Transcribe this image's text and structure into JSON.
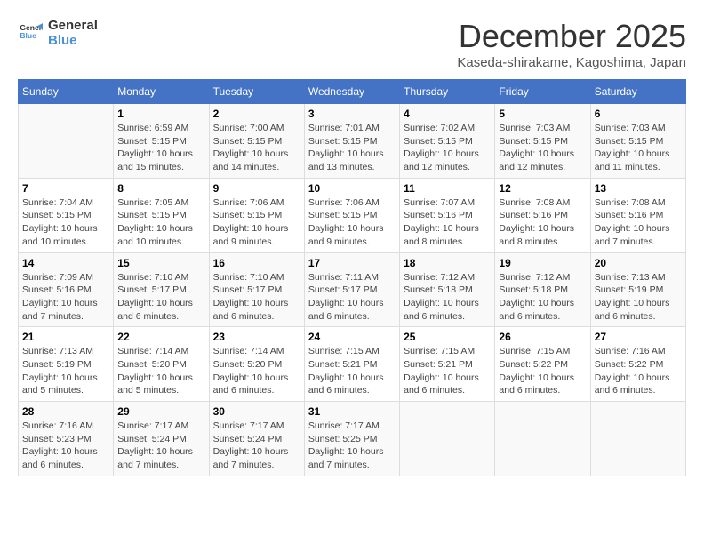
{
  "logo": {
    "line1": "General",
    "line2": "Blue"
  },
  "header": {
    "month_title": "December 2025",
    "location": "Kaseda-shirakame, Kagoshima, Japan"
  },
  "weekdays": [
    "Sunday",
    "Monday",
    "Tuesday",
    "Wednesday",
    "Thursday",
    "Friday",
    "Saturday"
  ],
  "weeks": [
    [
      {
        "day": "",
        "sunrise": "",
        "sunset": "",
        "daylight": ""
      },
      {
        "day": "1",
        "sunrise": "Sunrise: 6:59 AM",
        "sunset": "Sunset: 5:15 PM",
        "daylight": "Daylight: 10 hours and 15 minutes."
      },
      {
        "day": "2",
        "sunrise": "Sunrise: 7:00 AM",
        "sunset": "Sunset: 5:15 PM",
        "daylight": "Daylight: 10 hours and 14 minutes."
      },
      {
        "day": "3",
        "sunrise": "Sunrise: 7:01 AM",
        "sunset": "Sunset: 5:15 PM",
        "daylight": "Daylight: 10 hours and 13 minutes."
      },
      {
        "day": "4",
        "sunrise": "Sunrise: 7:02 AM",
        "sunset": "Sunset: 5:15 PM",
        "daylight": "Daylight: 10 hours and 12 minutes."
      },
      {
        "day": "5",
        "sunrise": "Sunrise: 7:03 AM",
        "sunset": "Sunset: 5:15 PM",
        "daylight": "Daylight: 10 hours and 12 minutes."
      },
      {
        "day": "6",
        "sunrise": "Sunrise: 7:03 AM",
        "sunset": "Sunset: 5:15 PM",
        "daylight": "Daylight: 10 hours and 11 minutes."
      }
    ],
    [
      {
        "day": "7",
        "sunrise": "Sunrise: 7:04 AM",
        "sunset": "Sunset: 5:15 PM",
        "daylight": "Daylight: 10 hours and 10 minutes."
      },
      {
        "day": "8",
        "sunrise": "Sunrise: 7:05 AM",
        "sunset": "Sunset: 5:15 PM",
        "daylight": "Daylight: 10 hours and 10 minutes."
      },
      {
        "day": "9",
        "sunrise": "Sunrise: 7:06 AM",
        "sunset": "Sunset: 5:15 PM",
        "daylight": "Daylight: 10 hours and 9 minutes."
      },
      {
        "day": "10",
        "sunrise": "Sunrise: 7:06 AM",
        "sunset": "Sunset: 5:15 PM",
        "daylight": "Daylight: 10 hours and 9 minutes."
      },
      {
        "day": "11",
        "sunrise": "Sunrise: 7:07 AM",
        "sunset": "Sunset: 5:16 PM",
        "daylight": "Daylight: 10 hours and 8 minutes."
      },
      {
        "day": "12",
        "sunrise": "Sunrise: 7:08 AM",
        "sunset": "Sunset: 5:16 PM",
        "daylight": "Daylight: 10 hours and 8 minutes."
      },
      {
        "day": "13",
        "sunrise": "Sunrise: 7:08 AM",
        "sunset": "Sunset: 5:16 PM",
        "daylight": "Daylight: 10 hours and 7 minutes."
      }
    ],
    [
      {
        "day": "14",
        "sunrise": "Sunrise: 7:09 AM",
        "sunset": "Sunset: 5:16 PM",
        "daylight": "Daylight: 10 hours and 7 minutes."
      },
      {
        "day": "15",
        "sunrise": "Sunrise: 7:10 AM",
        "sunset": "Sunset: 5:17 PM",
        "daylight": "Daylight: 10 hours and 6 minutes."
      },
      {
        "day": "16",
        "sunrise": "Sunrise: 7:10 AM",
        "sunset": "Sunset: 5:17 PM",
        "daylight": "Daylight: 10 hours and 6 minutes."
      },
      {
        "day": "17",
        "sunrise": "Sunrise: 7:11 AM",
        "sunset": "Sunset: 5:17 PM",
        "daylight": "Daylight: 10 hours and 6 minutes."
      },
      {
        "day": "18",
        "sunrise": "Sunrise: 7:12 AM",
        "sunset": "Sunset: 5:18 PM",
        "daylight": "Daylight: 10 hours and 6 minutes."
      },
      {
        "day": "19",
        "sunrise": "Sunrise: 7:12 AM",
        "sunset": "Sunset: 5:18 PM",
        "daylight": "Daylight: 10 hours and 6 minutes."
      },
      {
        "day": "20",
        "sunrise": "Sunrise: 7:13 AM",
        "sunset": "Sunset: 5:19 PM",
        "daylight": "Daylight: 10 hours and 6 minutes."
      }
    ],
    [
      {
        "day": "21",
        "sunrise": "Sunrise: 7:13 AM",
        "sunset": "Sunset: 5:19 PM",
        "daylight": "Daylight: 10 hours and 5 minutes."
      },
      {
        "day": "22",
        "sunrise": "Sunrise: 7:14 AM",
        "sunset": "Sunset: 5:20 PM",
        "daylight": "Daylight: 10 hours and 5 minutes."
      },
      {
        "day": "23",
        "sunrise": "Sunrise: 7:14 AM",
        "sunset": "Sunset: 5:20 PM",
        "daylight": "Daylight: 10 hours and 6 minutes."
      },
      {
        "day": "24",
        "sunrise": "Sunrise: 7:15 AM",
        "sunset": "Sunset: 5:21 PM",
        "daylight": "Daylight: 10 hours and 6 minutes."
      },
      {
        "day": "25",
        "sunrise": "Sunrise: 7:15 AM",
        "sunset": "Sunset: 5:21 PM",
        "daylight": "Daylight: 10 hours and 6 minutes."
      },
      {
        "day": "26",
        "sunrise": "Sunrise: 7:15 AM",
        "sunset": "Sunset: 5:22 PM",
        "daylight": "Daylight: 10 hours and 6 minutes."
      },
      {
        "day": "27",
        "sunrise": "Sunrise: 7:16 AM",
        "sunset": "Sunset: 5:22 PM",
        "daylight": "Daylight: 10 hours and 6 minutes."
      }
    ],
    [
      {
        "day": "28",
        "sunrise": "Sunrise: 7:16 AM",
        "sunset": "Sunset: 5:23 PM",
        "daylight": "Daylight: 10 hours and 6 minutes."
      },
      {
        "day": "29",
        "sunrise": "Sunrise: 7:17 AM",
        "sunset": "Sunset: 5:24 PM",
        "daylight": "Daylight: 10 hours and 7 minutes."
      },
      {
        "day": "30",
        "sunrise": "Sunrise: 7:17 AM",
        "sunset": "Sunset: 5:24 PM",
        "daylight": "Daylight: 10 hours and 7 minutes."
      },
      {
        "day": "31",
        "sunrise": "Sunrise: 7:17 AM",
        "sunset": "Sunset: 5:25 PM",
        "daylight": "Daylight: 10 hours and 7 minutes."
      },
      {
        "day": "",
        "sunrise": "",
        "sunset": "",
        "daylight": ""
      },
      {
        "day": "",
        "sunrise": "",
        "sunset": "",
        "daylight": ""
      },
      {
        "day": "",
        "sunrise": "",
        "sunset": "",
        "daylight": ""
      }
    ]
  ]
}
